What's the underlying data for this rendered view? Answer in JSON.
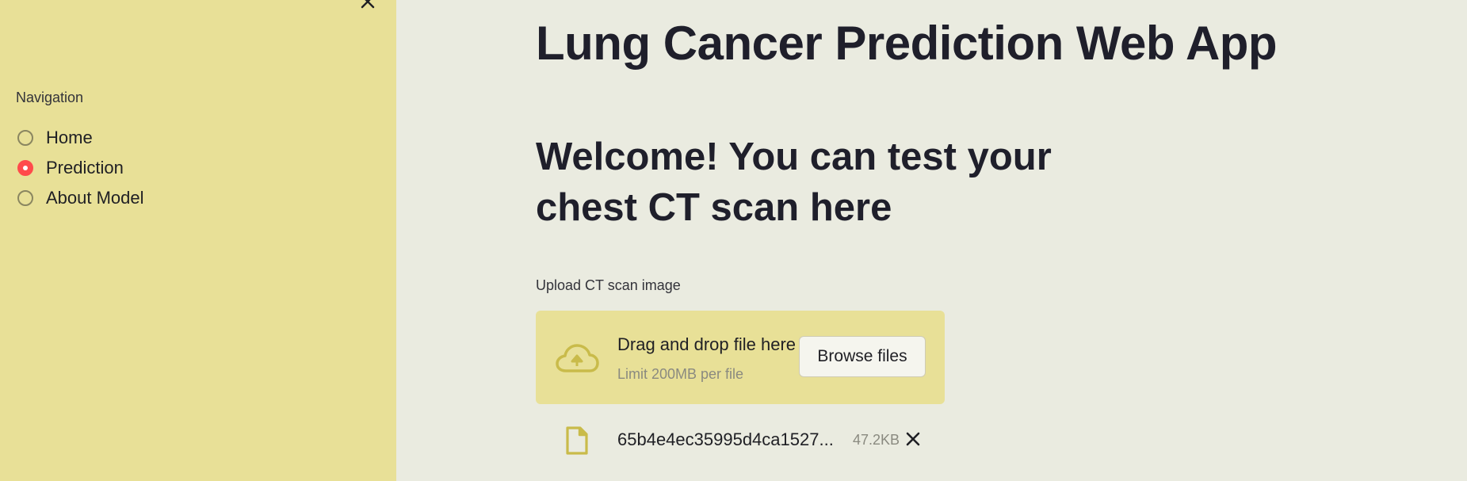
{
  "sidebar": {
    "close_icon": "close-icon",
    "nav_label": "Navigation",
    "items": [
      {
        "label": "Home",
        "selected": false
      },
      {
        "label": "Prediction",
        "selected": true
      },
      {
        "label": "About Model",
        "selected": false
      }
    ],
    "background_color": "#e8e097",
    "accent_color": "#ff4b4b"
  },
  "main": {
    "title": "Lung Cancer Prediction Web App",
    "subtitle": "Welcome! You can test your chest CT scan here",
    "upload": {
      "label": "Upload CT scan image",
      "drop_text": "Drag and drop file here",
      "limit_text": "Limit 200MB per file",
      "browse_label": "Browse files",
      "icon": "cloud-upload-icon"
    },
    "file": {
      "icon": "file-icon",
      "name": "65b4e4ec35995d4ca1527...",
      "size": "47.2KB",
      "remove_icon": "close-icon"
    },
    "background_color": "#eaebe0"
  }
}
